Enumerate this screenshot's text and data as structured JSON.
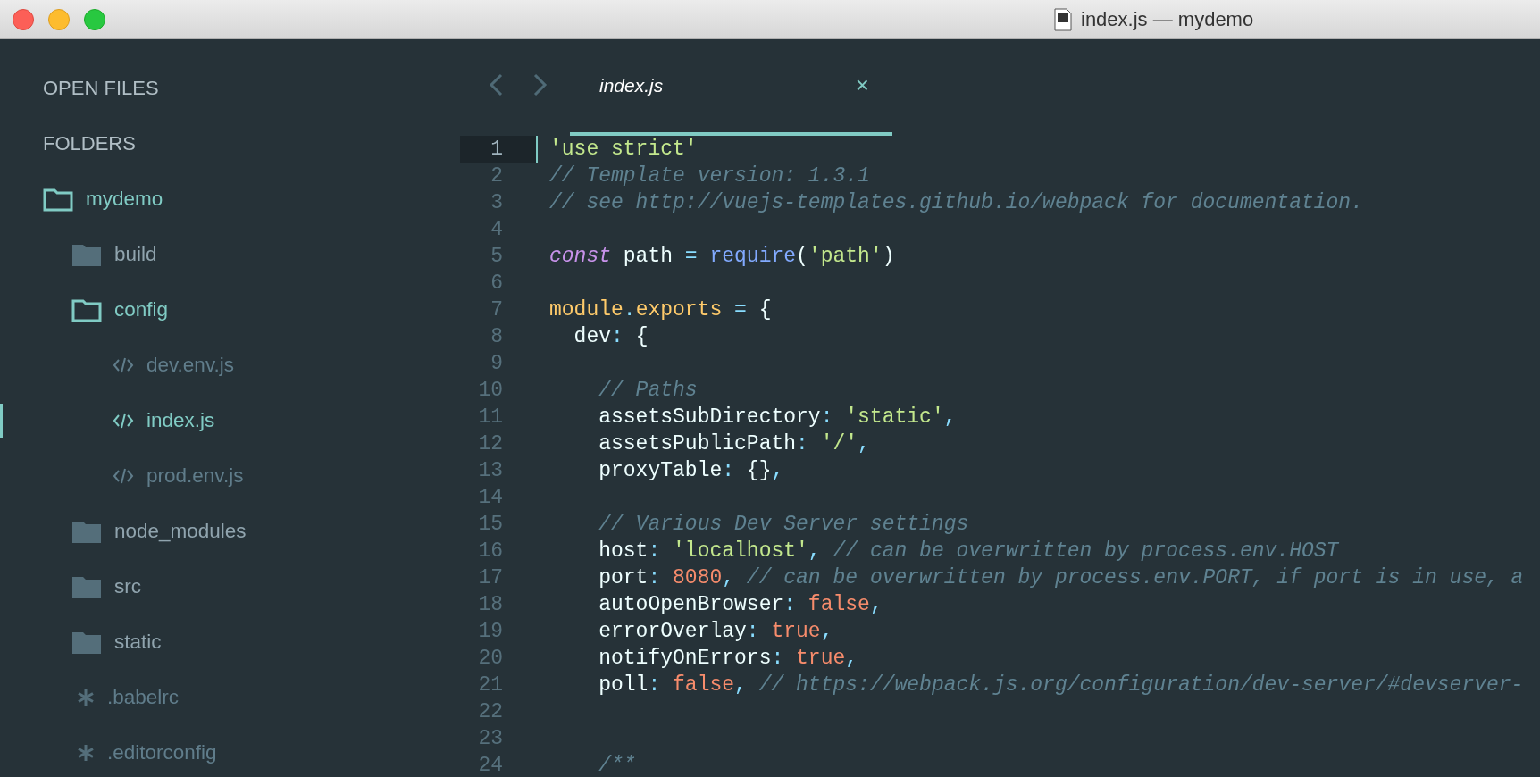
{
  "window": {
    "title": "index.js — mydemo"
  },
  "sidebar": {
    "sections": [
      "OPEN FILES",
      "FOLDERS"
    ],
    "tree": [
      {
        "name": "mydemo",
        "kind": "folder",
        "expanded": true,
        "selected": false,
        "children": [
          {
            "name": "build",
            "kind": "folder",
            "expanded": false,
            "selected": false
          },
          {
            "name": "config",
            "kind": "folder",
            "expanded": true,
            "selected": false,
            "children": [
              {
                "name": "dev.env.js",
                "kind": "code",
                "selected": false
              },
              {
                "name": "index.js",
                "kind": "code",
                "selected": true
              },
              {
                "name": "prod.env.js",
                "kind": "code",
                "selected": false
              }
            ]
          },
          {
            "name": "node_modules",
            "kind": "folder",
            "expanded": false,
            "selected": false
          },
          {
            "name": "src",
            "kind": "folder",
            "expanded": false,
            "selected": false
          },
          {
            "name": "static",
            "kind": "folder",
            "expanded": false,
            "selected": false
          },
          {
            "name": ".babelrc",
            "kind": "config",
            "selected": false
          },
          {
            "name": ".editorconfig",
            "kind": "config",
            "selected": false
          }
        ]
      }
    ]
  },
  "tabs": [
    {
      "label": "index.js",
      "selected": true,
      "close": "×"
    }
  ],
  "editor": {
    "lines": [
      {
        "number": "1",
        "current": true,
        "tokens": [
          {
            "kind": "str",
            "text": "'use strict'"
          }
        ]
      },
      {
        "number": "2",
        "current": false,
        "tokens": [
          {
            "kind": "com",
            "text": "// Template version: 1.3.1"
          }
        ]
      },
      {
        "number": "3",
        "current": false,
        "tokens": [
          {
            "kind": "com",
            "text": "// see http://vuejs-templates.github.io/webpack for documentation."
          }
        ]
      },
      {
        "number": "4",
        "current": false
      },
      {
        "number": "5",
        "current": false,
        "tokens": [
          {
            "kind": "kw",
            "text": "const"
          },
          {
            "kind": "plain",
            "text": " path "
          },
          {
            "kind": "punct",
            "text": "= "
          },
          {
            "kind": "fn",
            "text": "require"
          },
          {
            "kind": "plain",
            "text": "("
          },
          {
            "kind": "str",
            "text": "'path'"
          },
          {
            "kind": "plain",
            "text": ")"
          }
        ]
      },
      {
        "number": "6",
        "current": false
      },
      {
        "number": "7",
        "current": false,
        "tokens": [
          {
            "kind": "obj",
            "text": "module"
          },
          {
            "kind": "punct",
            "text": "."
          },
          {
            "kind": "obj",
            "text": "exports "
          },
          {
            "kind": "punct",
            "text": "= "
          },
          {
            "kind": "plain",
            "text": "{"
          }
        ]
      },
      {
        "number": "8",
        "current": false,
        "tokens": [
          {
            "kind": "plain",
            "text": "  dev"
          },
          {
            "kind": "punct",
            "text": ": "
          },
          {
            "kind": "plain",
            "text": "{"
          }
        ]
      },
      {
        "number": "9",
        "current": false
      },
      {
        "number": "10",
        "current": false,
        "tokens": [
          {
            "kind": "com",
            "text": "    // Paths"
          }
        ]
      },
      {
        "number": "11",
        "current": false,
        "tokens": [
          {
            "kind": "plain",
            "text": "    assetsSubDirectory"
          },
          {
            "kind": "punct",
            "text": ": "
          },
          {
            "kind": "str",
            "text": "'static'"
          },
          {
            "kind": "punct",
            "text": ","
          }
        ]
      },
      {
        "number": "12",
        "current": false,
        "tokens": [
          {
            "kind": "plain",
            "text": "    assetsPublicPath"
          },
          {
            "kind": "punct",
            "text": ": "
          },
          {
            "kind": "str",
            "text": "'/'"
          },
          {
            "kind": "punct",
            "text": ","
          }
        ]
      },
      {
        "number": "13",
        "current": false,
        "tokens": [
          {
            "kind": "plain",
            "text": "    proxyTable"
          },
          {
            "kind": "punct",
            "text": ": "
          },
          {
            "kind": "plain",
            "text": "{}"
          },
          {
            "kind": "punct",
            "text": ","
          }
        ]
      },
      {
        "number": "14",
        "current": false
      },
      {
        "number": "15",
        "current": false,
        "tokens": [
          {
            "kind": "com",
            "text": "    // Various Dev Server settings"
          }
        ]
      },
      {
        "number": "16",
        "current": false,
        "tokens": [
          {
            "kind": "plain",
            "text": "    host"
          },
          {
            "kind": "punct",
            "text": ": "
          },
          {
            "kind": "str",
            "text": "'localhost'"
          },
          {
            "kind": "punct",
            "text": ", "
          },
          {
            "kind": "com",
            "text": "// can be overwritten by process.env.HOST"
          }
        ]
      },
      {
        "number": "17",
        "current": false,
        "tokens": [
          {
            "kind": "plain",
            "text": "    port"
          },
          {
            "kind": "punct",
            "text": ": "
          },
          {
            "kind": "num",
            "text": "8080"
          },
          {
            "kind": "punct",
            "text": ", "
          },
          {
            "kind": "com",
            "text": "// can be overwritten by process.env.PORT, if port is in use, a"
          }
        ]
      },
      {
        "number": "18",
        "current": false,
        "tokens": [
          {
            "kind": "plain",
            "text": "    autoOpenBrowser"
          },
          {
            "kind": "punct",
            "text": ": "
          },
          {
            "kind": "num",
            "text": "false"
          },
          {
            "kind": "punct",
            "text": ","
          }
        ]
      },
      {
        "number": "19",
        "current": false,
        "tokens": [
          {
            "kind": "plain",
            "text": "    errorOverlay"
          },
          {
            "kind": "punct",
            "text": ": "
          },
          {
            "kind": "num",
            "text": "true"
          },
          {
            "kind": "punct",
            "text": ","
          }
        ]
      },
      {
        "number": "20",
        "current": false,
        "tokens": [
          {
            "kind": "plain",
            "text": "    notifyOnErrors"
          },
          {
            "kind": "punct",
            "text": ": "
          },
          {
            "kind": "num",
            "text": "true"
          },
          {
            "kind": "punct",
            "text": ","
          }
        ]
      },
      {
        "number": "21",
        "current": false,
        "tokens": [
          {
            "kind": "plain",
            "text": "    poll"
          },
          {
            "kind": "punct",
            "text": ": "
          },
          {
            "kind": "num",
            "text": "false"
          },
          {
            "kind": "punct",
            "text": ", "
          },
          {
            "kind": "com",
            "text": "// https://webpack.js.org/configuration/dev-server/#devserver-"
          }
        ]
      },
      {
        "number": "22",
        "current": false
      },
      {
        "number": "23",
        "current": false
      },
      {
        "number": "24",
        "current": false,
        "tokens": [
          {
            "kind": "com",
            "text": "    /**"
          }
        ]
      }
    ]
  }
}
